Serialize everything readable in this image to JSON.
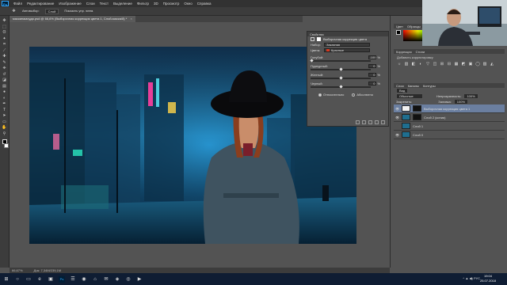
{
  "menubar": {
    "app_icon": "Ps",
    "items": [
      "Файл",
      "Редактирование",
      "Изображение",
      "Слои",
      "Текст",
      "Выделение",
      "Фильтр",
      "3D",
      "Просмотр",
      "Окно",
      "Справка"
    ]
  },
  "options": {
    "preset": "Автовыбор:",
    "target": "Слой",
    "checkbox": "Показать упр. элем."
  },
  "document": {
    "tab": "маскинамоуда.psd @ 66,6% (Выборочная коррекция цвета 1, Слой-маска/8) *",
    "close": "×"
  },
  "tools": [
    "move-icon",
    "marquee-icon",
    "lasso-icon",
    "wand-icon",
    "crop-icon",
    "eyedropper-icon",
    "healing-icon",
    "brush-icon",
    "stamp-icon",
    "history-brush-icon",
    "eraser-icon",
    "gradient-icon",
    "blur-icon",
    "dodge-icon",
    "pen-icon",
    "type-icon",
    "path-select-icon",
    "shape-icon",
    "hand-icon",
    "zoom-icon"
  ],
  "tool_glyphs": [
    "✥",
    "⬚",
    "ʘ",
    "✦",
    "⌗",
    "⟋",
    "✚",
    "✎",
    "⎈",
    "↺",
    "◪",
    "▤",
    "●",
    "◐",
    "✒",
    "T",
    "➤",
    "▭",
    "✋",
    "⚲"
  ],
  "status": {
    "zoom": "66,67%",
    "doc": "Док: 7,34M/239,1M"
  },
  "properties": {
    "title": "Свойства",
    "subtitle": "Выборочная коррекция цвета",
    "preset_label": "Набор:",
    "preset_value": "Заказная",
    "colors_label": "Цвета:",
    "colors_value": "Красные",
    "colors_swatch": "#d9381e",
    "sliders": [
      {
        "label": "Голубой:",
        "value": "-100",
        "unit": "%",
        "level": 0.0
      },
      {
        "label": "Пурпурный:",
        "value": "0",
        "unit": "%",
        "level": 0.5
      },
      {
        "label": "Желтый:",
        "value": "0",
        "unit": "%",
        "level": 0.5
      },
      {
        "label": "Черный:",
        "value": "0",
        "unit": "%",
        "level": 0.5
      }
    ],
    "method_relative": "Относительно",
    "method_absolute": "Абсолютно"
  },
  "color_panel": {
    "tabs": [
      "Цвет",
      "Образцы"
    ]
  },
  "corrections": {
    "tabs": [
      "Коррекция",
      "Стили"
    ],
    "add_label": "Добавить корректировку",
    "icons": [
      "☼",
      "▥",
      "◧",
      "◐",
      "▽",
      "◫",
      "⊞",
      "⊟",
      "▦",
      "◩",
      "▣",
      "◯",
      "▨",
      "◭"
    ]
  },
  "layers": {
    "tabs": [
      "Слои",
      "Каналы",
      "Контуры"
    ],
    "kind": "Вид",
    "blend_mode": "Обычные",
    "opacity_label": "Непрозрачность:",
    "opacity_value": "100%",
    "lock_label": "Закрепить:",
    "fill_label": "Заливка:",
    "fill_value": "100%",
    "items": [
      {
        "name": "Выборочная коррекция цвета 1",
        "eye": "👁",
        "selected": true
      },
      {
        "name": "Слой 2 (копия)",
        "eye": "👁",
        "selected": false
      },
      {
        "name": "Слой 1",
        "eye": "",
        "selected": false
      },
      {
        "name": "Слой 0",
        "eye": "👁",
        "selected": false
      }
    ]
  },
  "taskbar": {
    "icons": [
      "⊞",
      "○",
      "▭",
      "e",
      "▣",
      "Ps",
      "☰",
      "◉",
      "⌂",
      "✉",
      "◈",
      "◎",
      "▶"
    ],
    "tray": "^ ▲ ◀) РУС",
    "time": "19:04",
    "date": "25.07.2018"
  },
  "colors": {
    "accent_selected": "#6b7fa0",
    "swatch": "#d9381e"
  }
}
